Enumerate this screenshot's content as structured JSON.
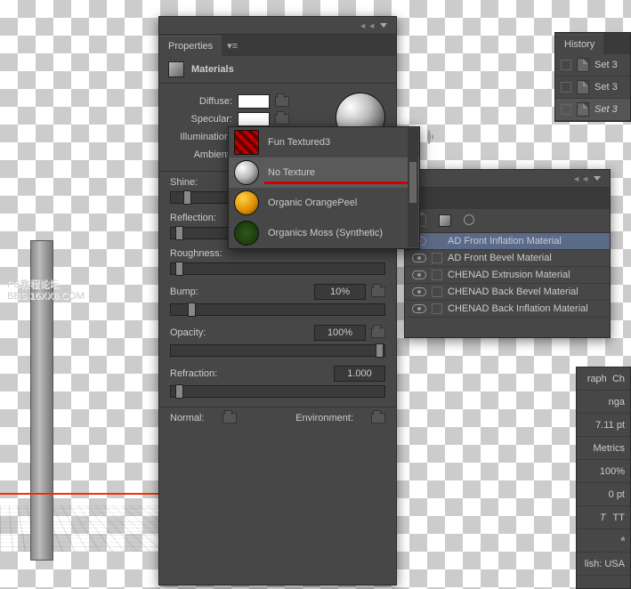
{
  "properties": {
    "title": "Properties",
    "section": "Materials",
    "labels": {
      "diffuse": "Diffuse:",
      "specular": "Specular:",
      "illumination": "Illumination:",
      "ambient": "Ambient:",
      "shine": "Shine:",
      "reflection": "Reflection:",
      "roughness": "Roughness:",
      "bump": "Bump:",
      "opacity": "Opacity:",
      "refraction": "Refraction:",
      "normal": "Normal:",
      "environment": "Environment:"
    },
    "values": {
      "bump": "10%",
      "opacity": "100%",
      "refraction": "1.000"
    },
    "swatches": {
      "diffuse": "#ffffff",
      "specular": "#ffffff",
      "illumination": "#000000",
      "ambient": "#000000"
    }
  },
  "texture_picker": {
    "items": [
      {
        "label": "Fun Textured3",
        "thumb": "repeating-linear-gradient(45deg,#b00 0 4px,#600 4px 8px)"
      },
      {
        "label": "No Texture",
        "thumb": "radial-gradient(circle at 32% 30%,#fff,#bbb 45%,#333)"
      },
      {
        "label": "Organic OrangePeel",
        "thumb": "radial-gradient(circle at 35% 30%,#ffd24a,#d98a00 60%,#6b3b00)"
      },
      {
        "label": "Organics Moss (Synthetic)",
        "thumb": "radial-gradient(circle,#2c5a1a,#163008)"
      }
    ],
    "hover_index": 1
  },
  "layers": {
    "items": [
      {
        "label": "AD Front Inflation Material",
        "selected": true,
        "short": true
      },
      {
        "label": "AD Front Bevel Material",
        "short": true
      },
      {
        "label": "CHENAD Extrusion Material"
      },
      {
        "label": "CHENAD Back Bevel Material"
      },
      {
        "label": "CHENAD Back Inflation Material"
      }
    ]
  },
  "history": {
    "title": "History",
    "items": [
      "Set 3",
      "Set 3",
      "Set 3"
    ]
  },
  "char": {
    "tab1": "raph",
    "tab2": "Ch",
    "font": "nga",
    "size": "7.11 pt",
    "kerning": "Metrics",
    "scale": "100%",
    "baseline": "0 pt",
    "caps": "T",
    "smallcaps": "TT",
    "lang": "lish: USA"
  },
  "watermark": {
    "l1": "PS教程论坛",
    "l2": "BBS.16XX6.COM"
  }
}
